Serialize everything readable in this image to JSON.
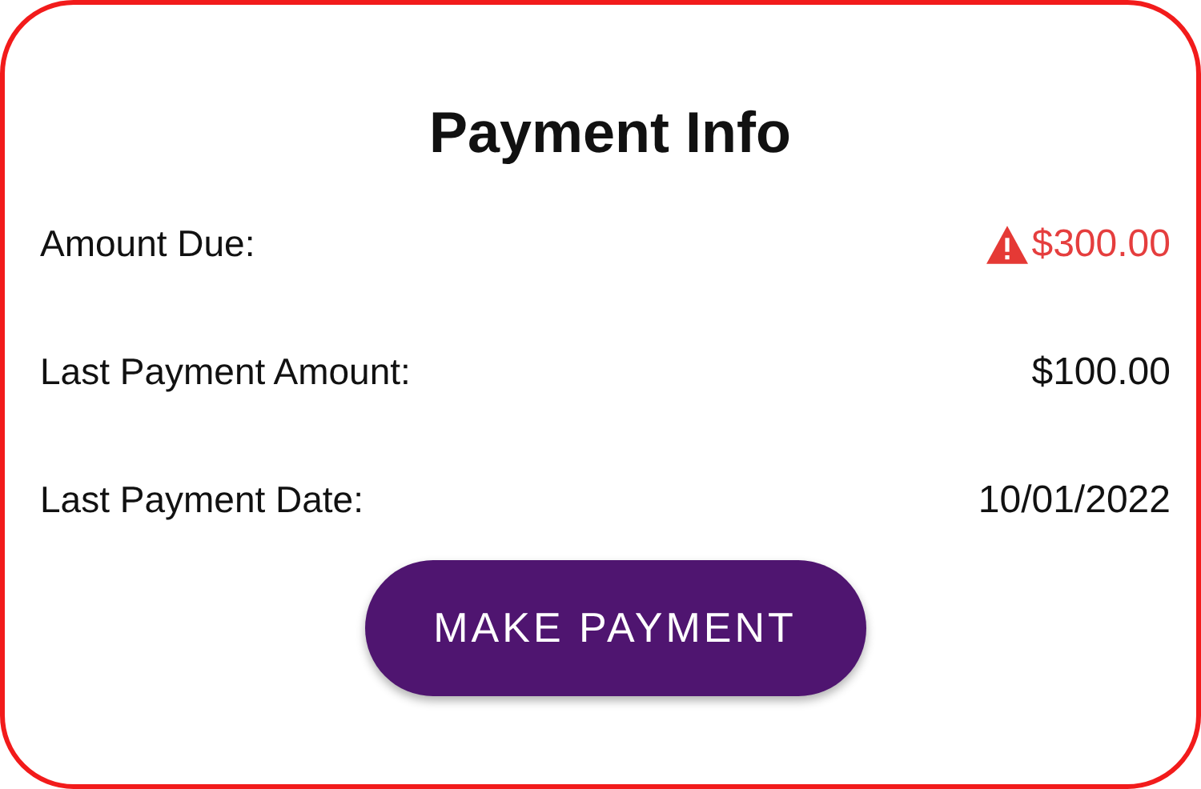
{
  "title": "Payment Info",
  "rows": [
    {
      "label": "Amount Due:",
      "value": "$300.00",
      "warning": true
    },
    {
      "label": "Last Payment Amount:",
      "value": "$100.00",
      "warning": false
    },
    {
      "label": "Last Payment Date:",
      "value": "10/01/2022",
      "warning": false
    }
  ],
  "button": "MAKE PAYMENT"
}
